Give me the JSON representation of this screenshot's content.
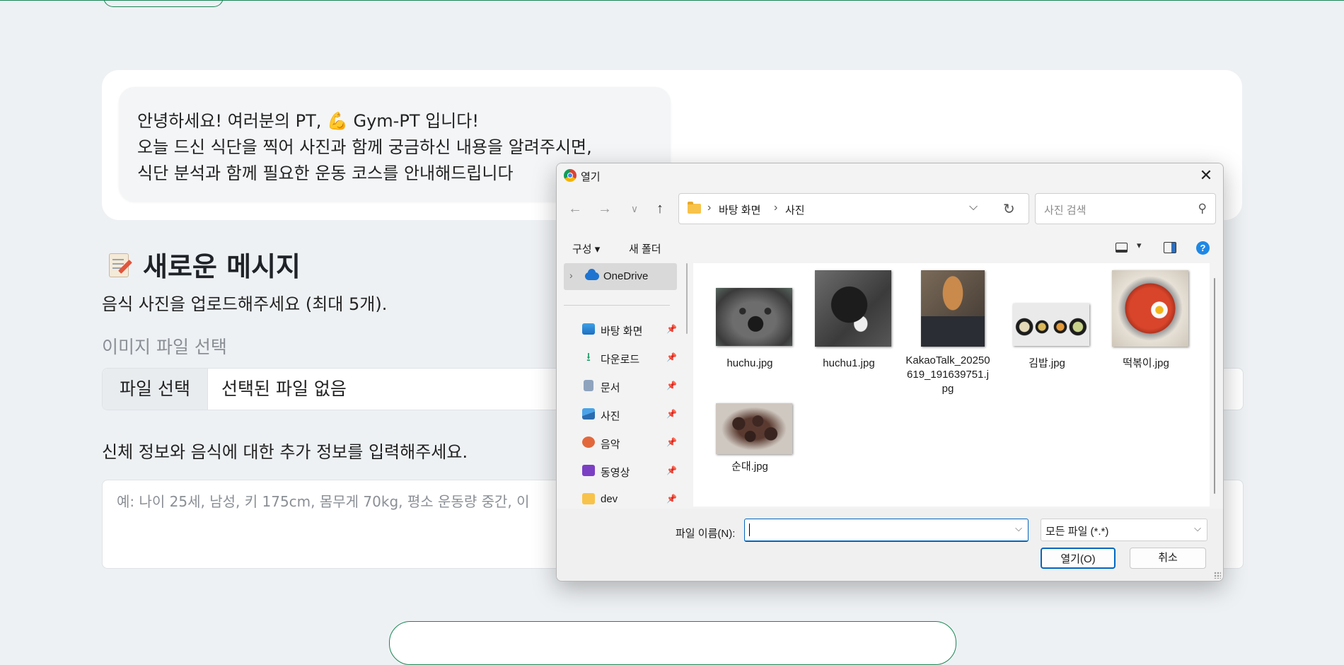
{
  "page": {
    "bot_message": {
      "line1": "안녕하세요! 여러분의 PT, 💪 Gym-PT 입니다!",
      "line2": "오늘 드신 식단을 찍어 사진과 함께 궁금하신 내용을 알려주시면,",
      "line3": "식단 분석과 함께 필요한 운동 코스를 안내해드립니다"
    },
    "section_title": "새로운 메시지",
    "section_icon": "memo-icon",
    "upload_instruction": "음식 사진을 업로드해주세요 (최대 5개).",
    "file_field_label": "이미지 파일 선택",
    "file_button_label": "파일 선택",
    "file_status": "선택된 파일 없음",
    "info_label": "신체 정보와 음식에 대한 추가 정보를 입력해주세요.",
    "info_placeholder": "예: 나이 25세, 남성, 키 175cm, 몸무게 70kg, 평소 운동량 중간, 이",
    "accent_color": "#198754"
  },
  "dialog": {
    "title": "열기",
    "close_label": "✕",
    "breadcrumb": [
      "바탕 화면",
      "사진"
    ],
    "search_placeholder": "사진 검색",
    "toolbar": {
      "organize_label": "구성 ▾",
      "new_folder_label": "새 폴더",
      "help_label": "?"
    },
    "nav": {
      "onedrive_label": "OneDrive",
      "items": [
        {
          "label": "바탕 화면",
          "icon": "desktop-icon"
        },
        {
          "label": "다운로드",
          "icon": "download-icon"
        },
        {
          "label": "문서",
          "icon": "document-icon"
        },
        {
          "label": "사진",
          "icon": "pictures-icon"
        },
        {
          "label": "음악",
          "icon": "music-icon"
        },
        {
          "label": "동영상",
          "icon": "video-icon"
        },
        {
          "label": "dev",
          "icon": "folder-icon"
        }
      ]
    },
    "files": [
      {
        "name": "huchu.jpg"
      },
      {
        "name": "huchu1.jpg"
      },
      {
        "name": "KakaoTalk_20250619_191639751.jpg"
      },
      {
        "name": "김밥.jpg"
      },
      {
        "name": "떡볶이.jpg"
      },
      {
        "name": "순대.jpg"
      }
    ],
    "filename_label": "파일 이름(N):",
    "filename_value": "",
    "filetype_value": "모든 파일 (*.*)",
    "open_button": "열기(O)",
    "cancel_button": "취소"
  }
}
